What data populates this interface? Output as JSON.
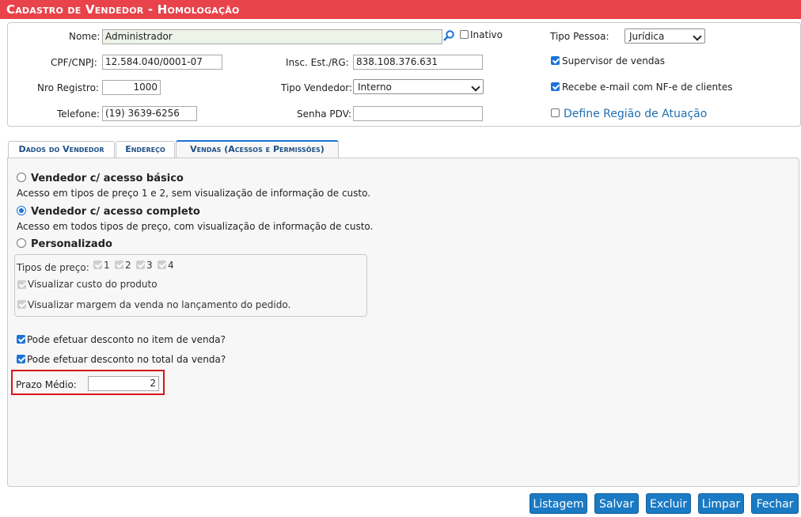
{
  "window": {
    "title": "Cadastro de Vendedor  - Homologação"
  },
  "header": {
    "nome_label": "Nome:",
    "nome_value": "Administrador",
    "inativo_label": "Inativo",
    "inativo_checked": false,
    "tipo_pessoa_label": "Tipo Pessoa:",
    "tipo_pessoa_value": "Jurídica",
    "cpf_label": "CPF/CNPJ:",
    "cpf_value": "12.584.040/0001-07",
    "insc_label": "Insc. Est./RG:",
    "insc_value": "838.108.376.631",
    "supervisor_label": "Supervisor de vendas",
    "supervisor_checked": true,
    "nro_registro_label": "Nro Registro:",
    "nro_registro_value": "1000",
    "tipo_vendedor_label": "Tipo Vendedor:",
    "tipo_vendedor_value": "Interno",
    "recebe_email_label": "Recebe e-mail com NF-e de clientes",
    "recebe_email_checked": true,
    "telefone_label": "Telefone:",
    "telefone_value": "(19) 3639-6256",
    "senha_label": "Senha PDV:",
    "senha_value": "",
    "regiao_label": "Define Região de Atuação",
    "regiao_checked": false
  },
  "tabs": [
    {
      "label": "Dados do Vendedor",
      "active": false
    },
    {
      "label": "Endereço",
      "active": false
    },
    {
      "label": "Vendas (Acessos e Permissões)",
      "active": true
    }
  ],
  "vendas": {
    "opt_basico_label": "Vendedor c/ acesso básico",
    "opt_basico_desc": "Acesso em tipos de preço 1 e 2, sem visualização de informação de custo.",
    "opt_completo_label": "Vendedor c/ acesso completo",
    "opt_completo_desc": "Acesso em todos tipos de preço, com visualização de informação de custo.",
    "opt_personalizado_label": "Personalizado",
    "selected_option": "completo",
    "tipos_preco_label": "Tipos de preço:",
    "tipos_preco": [
      "1",
      "2",
      "3",
      "4"
    ],
    "visualizar_custo_label": "Visualizar custo do produto",
    "visualizar_margem_label": "Visualizar margem da venda no lançamento do pedido.",
    "desconto_item_label": "Pode efetuar desconto no item de venda?",
    "desconto_item_checked": true,
    "desconto_total_label": "Pode efetuar desconto no total da venda?",
    "desconto_total_checked": true,
    "prazo_medio_label": "Prazo Médio:",
    "prazo_medio_value": "2"
  },
  "buttons": {
    "listagem": "Listagem",
    "salvar": "Salvar",
    "excluir": "Excluir",
    "limpar": "Limpar",
    "fechar": "Fechar"
  },
  "colors": {
    "title_bar": "#e8424a",
    "button": "#1a7ac4",
    "highlight_box": "#d9151a",
    "link": "#1f6fb2"
  }
}
